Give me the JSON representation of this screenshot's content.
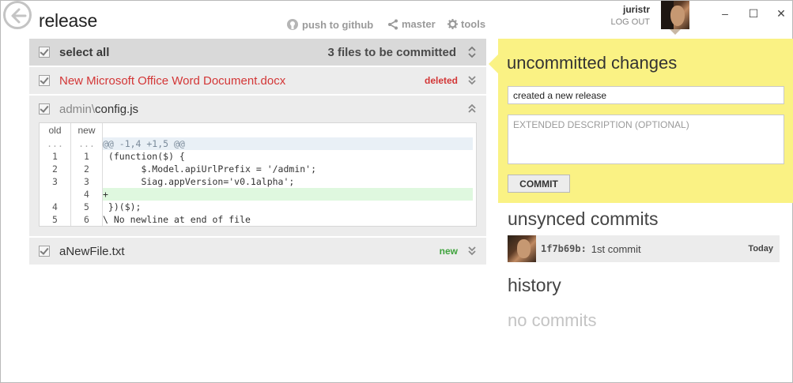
{
  "repo": {
    "name": "release"
  },
  "topnav": {
    "push_label": "push to github",
    "branch_label": "master",
    "tools_label": "tools"
  },
  "user": {
    "name": "juristr",
    "logout_label": "LOG OUT"
  },
  "window_controls": {
    "minimize": "–",
    "maximize": "☐",
    "close": "✕"
  },
  "changes": {
    "select_all_label": "select all",
    "count_label": "3 files to be committed",
    "files": [
      {
        "name": "New Microsoft Office Word Document.docx",
        "status": "deleted",
        "checked": true
      },
      {
        "path_dir": "admin\\",
        "path_file": "config.js",
        "status": "",
        "checked": true,
        "expanded": true
      },
      {
        "name": "aNewFile.txt",
        "status": "new",
        "checked": true
      }
    ]
  },
  "diff": {
    "old_header": "old",
    "new_header": "new",
    "lines": [
      {
        "old": "...",
        "new": "...",
        "code": "@@ -1,4 +1,5 @@",
        "type": "hunk"
      },
      {
        "old": "1",
        "new": "1",
        "code": " (function($) {",
        "type": "context"
      },
      {
        "old": "2",
        "new": "2",
        "code": "       $.Model.apiUrlPrefix = '/admin';",
        "type": "context"
      },
      {
        "old": "3",
        "new": "3",
        "code": "       Siag.appVersion='v0.1alpha';",
        "type": "context"
      },
      {
        "old": "",
        "new": "4",
        "code": "+",
        "type": "add"
      },
      {
        "old": "4",
        "new": "5",
        "code": " })($);",
        "type": "context"
      },
      {
        "old": "5",
        "new": "6",
        "code": "\\ No newline at end of file",
        "type": "context"
      }
    ]
  },
  "uncommitted": {
    "title": "uncommitted changes",
    "summary_value": "created a new release",
    "description_placeholder": "EXTENDED DESCRIPTION (OPTIONAL)",
    "commit_label": "COMMIT"
  },
  "unsynced": {
    "title": "unsynced commits",
    "commits": [
      {
        "sha": "1f7b69b:",
        "message": "1st commit",
        "when": "Today"
      }
    ]
  },
  "history": {
    "title": "history",
    "empty_label": "no commits"
  },
  "colors": {
    "panel_yellow": "#faf284",
    "deleted_red": "#d33636",
    "new_green": "#3ea33c",
    "row_gray": "#ececec"
  }
}
